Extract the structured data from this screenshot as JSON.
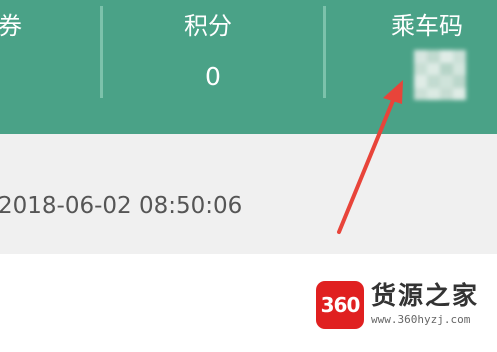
{
  "header": {
    "coupon_label": "券",
    "points_label": "积分",
    "points_value": "0",
    "ride_code_label": "乘车码",
    "background_color": "#4aa287",
    "divider_color": "#7cc2ab"
  },
  "qr_code": {
    "state": "blurred",
    "cells": [
      "#dfeae5",
      "#c7ddd3",
      "#e9f1ed",
      "#d2e4dc",
      "#cfe2d9",
      "#e5efea",
      "#bcd7cb",
      "#dceae3",
      "#e8f0ec",
      "#c9dfd5",
      "#d7e7df",
      "#c2dacf",
      "#d3e4dc",
      "#e3eee8",
      "#cde0d7",
      "#e7f0eb"
    ]
  },
  "info_row": {
    "timestamp": "2018-06-02 08:50:06",
    "background_color": "#f0f0f0"
  },
  "annotation": {
    "arrow_color": "#e8443a",
    "points_to": "ride-code"
  },
  "watermark": {
    "logo_text": "360",
    "title": "货源之家",
    "url": "www.360hyzj.com",
    "logo_color": "#e02020"
  }
}
